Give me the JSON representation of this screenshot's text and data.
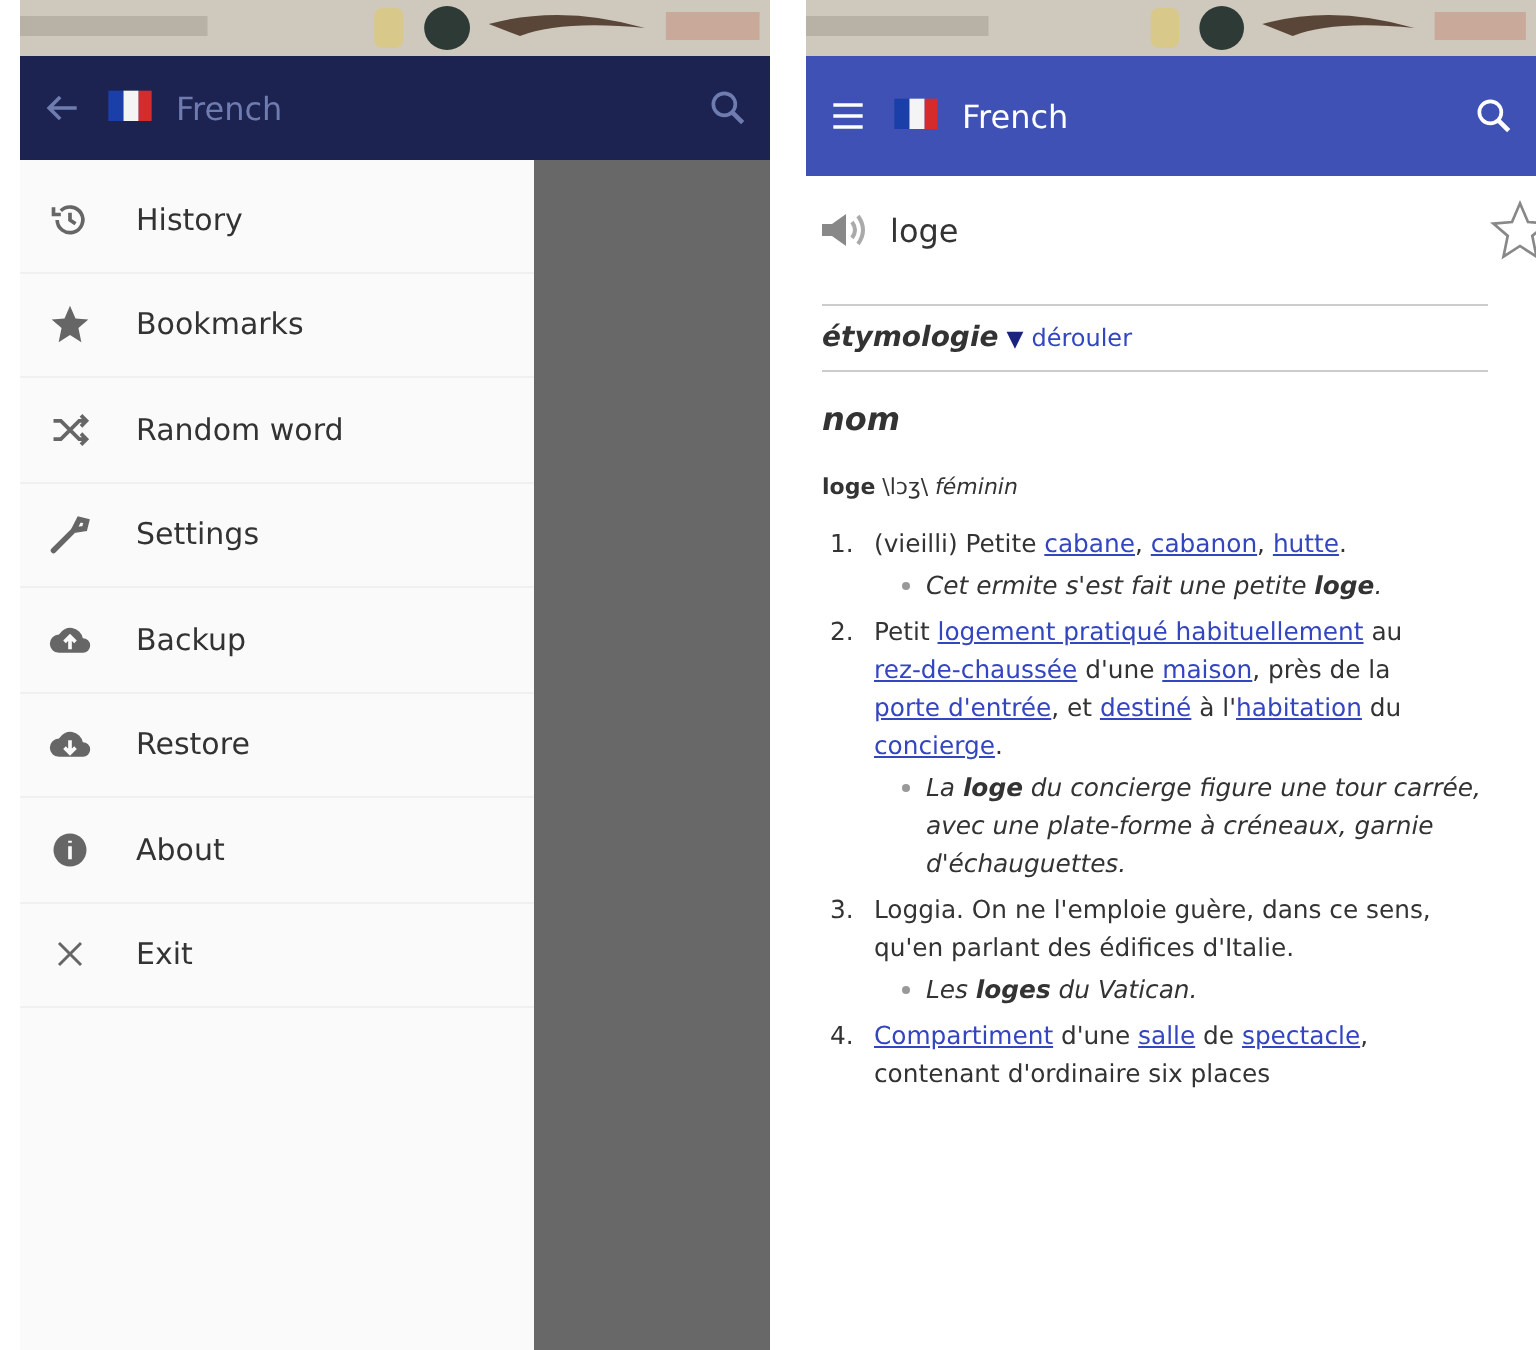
{
  "left_screen": {
    "app_bar": {
      "title": "French"
    },
    "drawer": {
      "items": [
        {
          "label": "History"
        },
        {
          "label": "Bookmarks"
        },
        {
          "label": "Random word"
        },
        {
          "label": "Settings"
        },
        {
          "label": "Backup"
        },
        {
          "label": "Restore"
        },
        {
          "label": "About"
        },
        {
          "label": "Exit"
        }
      ]
    }
  },
  "right_screen": {
    "app_bar": {
      "title": "French"
    },
    "word": "loge",
    "bookmarked": false,
    "etymology": {
      "title": "étymologie",
      "toggle": "▼",
      "link": "dérouler"
    },
    "part_of_speech": "nom",
    "headword_line": "**loge** \\lɔʒ\\ *féminin*",
    "definitions": [
      {
        "number": "1.",
        "segments": [
          {
            "kind": "text",
            "text": "(vieilli) Petite "
          },
          {
            "kind": "link",
            "text": "cabane"
          },
          {
            "kind": "text",
            "text": ", "
          },
          {
            "kind": "link",
            "text": "cabanon"
          },
          {
            "kind": "text",
            "text": ", "
          },
          {
            "kind": "link",
            "text": "hutte"
          },
          {
            "kind": "text",
            "text": "."
          }
        ],
        "example": "Cet ermite s'est fait une petite **loge**."
      },
      {
        "number": "2.",
        "segments": [
          {
            "kind": "text",
            "text": "Petit "
          },
          {
            "kind": "link",
            "text": "logement pratiqué habituellement"
          },
          {
            "kind": "text",
            "text": " au "
          },
          {
            "kind": "link",
            "text": "rez-de-chaussée"
          },
          {
            "kind": "text",
            "text": " d'une "
          },
          {
            "kind": "link",
            "text": "maison"
          },
          {
            "kind": "text",
            "text": ", près de la "
          },
          {
            "kind": "link",
            "text": "porte d'entrée"
          },
          {
            "kind": "text",
            "text": ", et "
          },
          {
            "kind": "link",
            "text": "destiné"
          },
          {
            "kind": "text",
            "text": " à l'"
          },
          {
            "kind": "link",
            "text": "habitation"
          },
          {
            "kind": "text",
            "text": " du "
          },
          {
            "kind": "link",
            "text": "concierge"
          },
          {
            "kind": "text",
            "text": "."
          }
        ],
        "example": "La **loge** du concierge figure une tour carrée, avec une plate-forme à créneaux, garnie d'échauguettes."
      },
      {
        "number": "3.",
        "segments": [
          {
            "kind": "text",
            "text": "Loggia. On ne l'emploie guère, dans ce sens, qu'en parlant des édifices d'Italie."
          }
        ],
        "example": "Les **loges** du Vatican."
      },
      {
        "number": "4.",
        "segments": [
          {
            "kind": "link",
            "text": "Compartiment"
          },
          {
            "kind": "text",
            "text": " d'une "
          },
          {
            "kind": "link",
            "text": "salle"
          },
          {
            "kind": "text",
            "text": " de "
          },
          {
            "kind": "link",
            "text": "spectacle"
          },
          {
            "kind": "text",
            "text": ", contenant d'ordinaire six places"
          }
        ]
      }
    ]
  }
}
